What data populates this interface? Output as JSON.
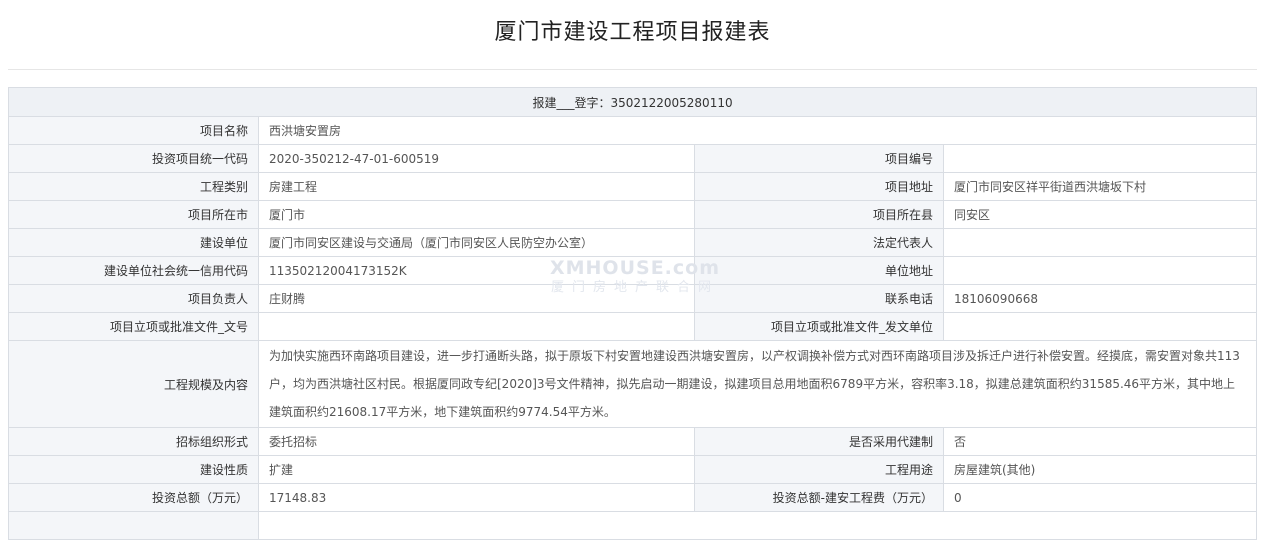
{
  "page_title": "厦门市建设工程项目报建表",
  "header_row": "报建___登字：3502122005280110",
  "watermark": {
    "main": "XMHOUSE.com",
    "sub": "厦门房地产联合网"
  },
  "fields": {
    "project_name": {
      "label": "项目名称",
      "value": "西洪塘安置房"
    },
    "investment_code": {
      "label": "投资项目统一代码",
      "value": "2020-350212-47-01-600519"
    },
    "project_number": {
      "label": "项目编号",
      "value": ""
    },
    "project_category": {
      "label": "工程类别",
      "value": "房建工程"
    },
    "project_address": {
      "label": "项目地址",
      "value": "厦门市同安区祥平街道西洪塘坂下村"
    },
    "project_city": {
      "label": "项目所在市",
      "value": "厦门市"
    },
    "project_county": {
      "label": "项目所在县",
      "value": "同安区"
    },
    "construction_unit": {
      "label": "建设单位",
      "value": "厦门市同安区建设与交通局（厦门市同安区人民防空办公室）"
    },
    "legal_rep": {
      "label": "法定代表人",
      "value": ""
    },
    "credit_code": {
      "label": "建设单位社会统一信用代码",
      "value": "11350212004173152K"
    },
    "unit_address": {
      "label": "单位地址",
      "value": ""
    },
    "project_leader": {
      "label": "项目负责人",
      "value": "庄财腾"
    },
    "phone": {
      "label": "联系电话",
      "value": "18106090668"
    },
    "approval_doc_no": {
      "label": "项目立项或批准文件_文号",
      "value": ""
    },
    "approval_issuer": {
      "label": "项目立项或批准文件_发文单位",
      "value": ""
    },
    "scale_content": {
      "label": "工程规模及内容",
      "value": "为加快实施西环南路项目建设，进一步打通断头路，拟于原坂下村安置地建设西洪塘安置房，以产权调换补偿方式对西环南路项目涉及拆迁户进行补偿安置。经摸底，需安置对象共113户，均为西洪塘社区村民。根据厦同政专纪[2020]3号文件精神，拟先启动一期建设，拟建项目总用地面积6789平方米，容积率3.18，拟建总建筑面积约31585.46平方米，其中地上建筑面积约21608.17平方米，地下建筑面积约9774.54平方米。"
    },
    "tender_form": {
      "label": "招标组织形式",
      "value": "委托招标"
    },
    "agent_system": {
      "label": "是否采用代建制",
      "value": "否"
    },
    "construction_nature": {
      "label": "建设性质",
      "value": "扩建"
    },
    "engineering_use": {
      "label": "工程用途",
      "value": "房屋建筑(其他)"
    },
    "total_investment": {
      "label": "投资总额（万元）",
      "value": "17148.83"
    },
    "install_cost": {
      "label": "投资总额-建安工程费（万元）",
      "value": "0"
    }
  }
}
